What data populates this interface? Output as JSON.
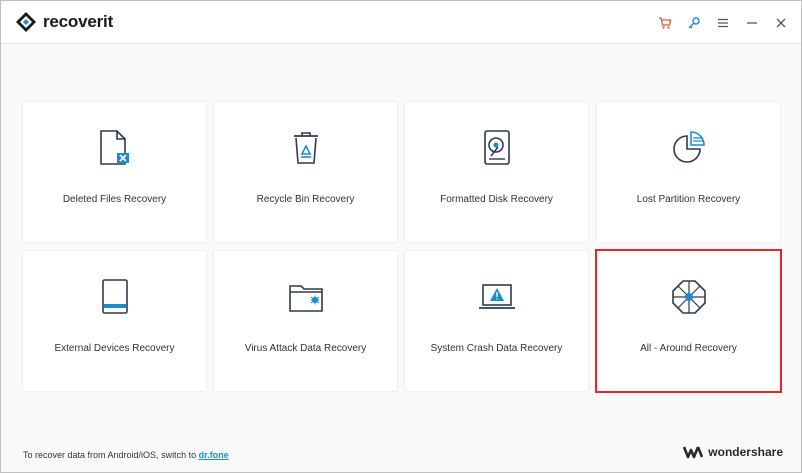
{
  "app": {
    "name_prefix": "recover",
    "name_suffix": "it",
    "accent": "#1a8ccf",
    "selection_color": "#e3262a"
  },
  "titlebar": {
    "icons": [
      "cart-icon",
      "key-icon",
      "menu-icon",
      "minimize-icon",
      "close-icon"
    ]
  },
  "cards": [
    {
      "label": "Deleted Files Recovery",
      "icon": "deleted-file-icon",
      "selected": false
    },
    {
      "label": "Recycle Bin Recovery",
      "icon": "recycle-bin-icon",
      "selected": false
    },
    {
      "label": "Formatted Disk Recovery",
      "icon": "formatted-disk-icon",
      "selected": false
    },
    {
      "label": "Lost Partition Recovery",
      "icon": "partition-pie-icon",
      "selected": false
    },
    {
      "label": "External Devices Recovery",
      "icon": "external-device-icon",
      "selected": false
    },
    {
      "label": "Virus Attack Data Recovery",
      "icon": "virus-folder-icon",
      "selected": false
    },
    {
      "label": "System Crash Data Recovery",
      "icon": "crashed-laptop-icon",
      "selected": false
    },
    {
      "label": "All - Around Recovery",
      "icon": "all-around-icon",
      "selected": true
    }
  ],
  "footer": {
    "text": "To recover data from Android/iOS, switch to ",
    "link": "dr.fone",
    "brand": "wondershare"
  }
}
